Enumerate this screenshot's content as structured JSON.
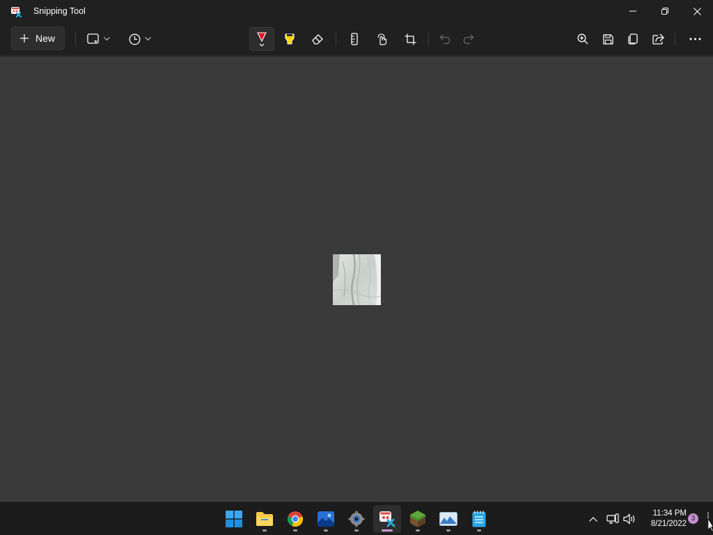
{
  "window": {
    "title": "Snipping Tool",
    "controls": {
      "minimize": "minimize-icon",
      "restore": "restore-icon",
      "close": "close-icon"
    }
  },
  "toolbar": {
    "new_label": "New",
    "tools": [
      {
        "name": "snipping-mode",
        "icon": "rectangle-snip-icon",
        "has_dropdown": true
      },
      {
        "name": "delay",
        "icon": "clock-icon",
        "has_dropdown": true
      },
      {
        "name": "ballpoint-pen",
        "icon": "pen-icon",
        "selected": true
      },
      {
        "name": "highlighter",
        "icon": "highlighter-icon"
      },
      {
        "name": "eraser",
        "icon": "eraser-icon"
      },
      {
        "name": "ruler",
        "icon": "ruler-icon"
      },
      {
        "name": "touch-writing",
        "icon": "touch-writing-icon"
      },
      {
        "name": "crop",
        "icon": "crop-icon"
      },
      {
        "name": "undo",
        "icon": "undo-icon",
        "disabled": true
      },
      {
        "name": "redo",
        "icon": "redo-icon",
        "disabled": true
      },
      {
        "name": "zoom",
        "icon": "zoom-in-icon"
      },
      {
        "name": "save",
        "icon": "save-icon"
      },
      {
        "name": "copy",
        "icon": "copy-icon"
      },
      {
        "name": "share",
        "icon": "share-icon"
      },
      {
        "name": "more",
        "icon": "more-icon"
      }
    ]
  },
  "taskbar": {
    "apps": [
      {
        "name": "start",
        "icon": "windows-logo-icon"
      },
      {
        "name": "file-explorer",
        "icon": "folder-icon",
        "running": true
      },
      {
        "name": "chrome",
        "icon": "chrome-icon",
        "running": true
      },
      {
        "name": "photos",
        "icon": "photos-icon",
        "running": true
      },
      {
        "name": "settings",
        "icon": "gear-icon",
        "running": true
      },
      {
        "name": "snipping-tool",
        "icon": "snipping-tool-icon",
        "running": true,
        "active": true
      },
      {
        "name": "minecraft",
        "icon": "grass-block-icon",
        "running": true
      },
      {
        "name": "image-viewer",
        "icon": "landscape-icon",
        "running": true
      },
      {
        "name": "notepad",
        "icon": "notepad-icon",
        "running": true
      }
    ],
    "tray": {
      "time": "11:34 PM",
      "date": "8/21/2022",
      "notification_count": "3"
    }
  },
  "colors": {
    "titlebar": "#202020",
    "canvas": "#3a3a3a",
    "taskbar": "#1c1c1c",
    "pen_red": "#e81123",
    "highlighter_yellow": "#ffd700",
    "active_indicator": "#d19ad8"
  }
}
